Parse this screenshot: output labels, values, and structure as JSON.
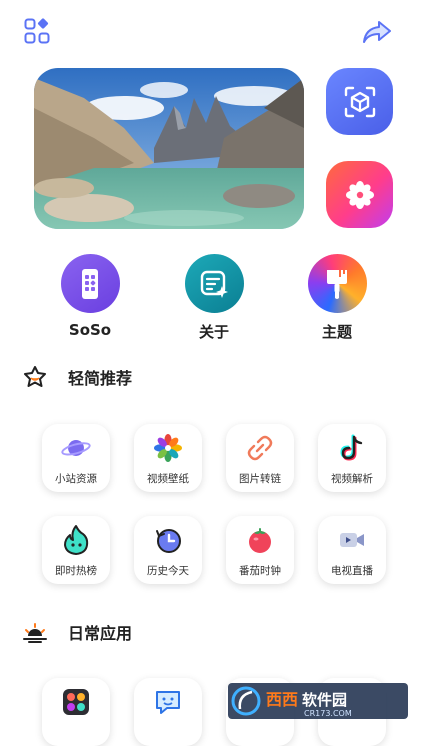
{
  "actions": [
    {
      "label": "SoSo"
    },
    {
      "label": "关于"
    },
    {
      "label": "主题"
    }
  ],
  "sections": {
    "recommend": {
      "title": "轻简推荐",
      "tiles": [
        {
          "label": "小站资源",
          "icon": "planet-icon"
        },
        {
          "label": "视频壁纸",
          "icon": "flower-icon"
        },
        {
          "label": "图片转链",
          "icon": "link-icon"
        },
        {
          "label": "视频解析",
          "icon": "tiktok-icon"
        },
        {
          "label": "即时热榜",
          "icon": "flame-icon"
        },
        {
          "label": "历史今天",
          "icon": "history-clock-icon"
        },
        {
          "label": "番茄时钟",
          "icon": "tomato-icon"
        },
        {
          "label": "电视直播",
          "icon": "video-camera-icon"
        }
      ]
    },
    "daily": {
      "title": "日常应用"
    }
  },
  "colors": {
    "accent_blue": "#5b73f5",
    "tile_shadow": "#e6e6e6"
  },
  "watermark": {
    "brand": "西西软件园",
    "url": "CR173.COM"
  }
}
